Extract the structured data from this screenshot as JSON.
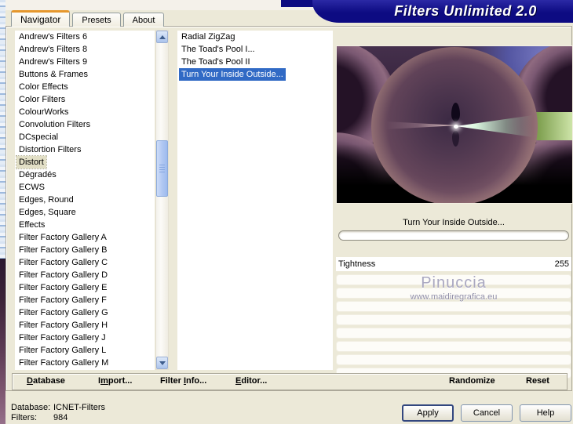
{
  "window": {
    "title": "Filters Unlimited 2.0"
  },
  "tabs": [
    {
      "label": "Navigator",
      "selected": true
    },
    {
      "label": "Presets",
      "selected": false
    },
    {
      "label": "About",
      "selected": false
    }
  ],
  "categories": [
    {
      "label": "Andrew's Filters 6",
      "selected": false
    },
    {
      "label": "Andrew's Filters 8",
      "selected": false
    },
    {
      "label": "Andrew's Filters 9",
      "selected": false
    },
    {
      "label": "Buttons & Frames",
      "selected": false
    },
    {
      "label": "Color Effects",
      "selected": false
    },
    {
      "label": "Color Filters",
      "selected": false
    },
    {
      "label": "ColourWorks",
      "selected": false
    },
    {
      "label": "Convolution Filters",
      "selected": false
    },
    {
      "label": "DCspecial",
      "selected": false
    },
    {
      "label": "Distortion Filters",
      "selected": false
    },
    {
      "label": "Distort",
      "selected": true
    },
    {
      "label": "Dégradés",
      "selected": false
    },
    {
      "label": "ECWS",
      "selected": false
    },
    {
      "label": "Edges, Round",
      "selected": false
    },
    {
      "label": "Edges, Square",
      "selected": false
    },
    {
      "label": "Effects",
      "selected": false
    },
    {
      "label": "Filter Factory Gallery A",
      "selected": false
    },
    {
      "label": "Filter Factory Gallery B",
      "selected": false
    },
    {
      "label": "Filter Factory Gallery C",
      "selected": false
    },
    {
      "label": "Filter Factory Gallery D",
      "selected": false
    },
    {
      "label": "Filter Factory Gallery E",
      "selected": false
    },
    {
      "label": "Filter Factory Gallery F",
      "selected": false
    },
    {
      "label": "Filter Factory Gallery G",
      "selected": false
    },
    {
      "label": "Filter Factory Gallery H",
      "selected": false
    },
    {
      "label": "Filter Factory Gallery J",
      "selected": false
    },
    {
      "label": "Filter Factory Gallery L",
      "selected": false
    },
    {
      "label": "Filter Factory Gallery M",
      "selected": false
    }
  ],
  "filters": [
    {
      "label": "Radial ZigZag",
      "selected": false
    },
    {
      "label": "The Toad's Pool I...",
      "selected": false
    },
    {
      "label": "The Toad's Pool II",
      "selected": false
    },
    {
      "label": "Turn Your Inside Outside...",
      "selected": true
    }
  ],
  "preview": {
    "caption": "Turn Your Inside Outside..."
  },
  "parameters": {
    "rows": [
      {
        "name": "Tightness",
        "value": "255"
      }
    ]
  },
  "watermark": {
    "name": "Pinuccia",
    "url": "www.maidiregrafica.eu"
  },
  "toolbar": {
    "menu": [
      {
        "pre": "",
        "key": "D",
        "post": "atabase"
      },
      {
        "pre": "I",
        "key": "m",
        "post": "port..."
      },
      {
        "pre": "Filter ",
        "key": "I",
        "post": "nfo..."
      },
      {
        "pre": "",
        "key": "E",
        "post": "ditor..."
      }
    ],
    "randomize": "Randomize",
    "reset": "Reset"
  },
  "status": {
    "rows": [
      {
        "label": "Database:",
        "value": "ICNET-Filters"
      },
      {
        "label": "Filters:",
        "value": "984"
      }
    ]
  },
  "buttons": {
    "apply": "Apply",
    "cancel": "Cancel",
    "help": "Help"
  },
  "colors": {
    "banner": "#0d0b82",
    "selection_blue": "#316ac5",
    "category_selection": "#e2dfc6",
    "tab_accent_orange": "#e5972d",
    "dialog_bg": "#ece9d8"
  }
}
